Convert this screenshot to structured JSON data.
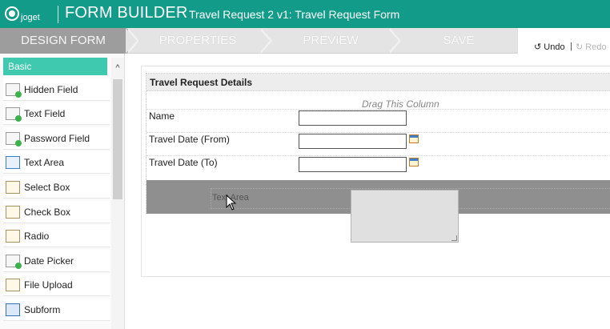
{
  "header": {
    "logo_text": "joget",
    "app_title": "FORM BUILDER",
    "form_title": "Travel Request 2 v1: Travel Request Form",
    "background": "#139b8a"
  },
  "steps": [
    {
      "label": "DESIGN FORM",
      "active": true
    },
    {
      "label": "PROPERTIES",
      "active": false
    },
    {
      "label": "PREVIEW",
      "active": false
    },
    {
      "label": "SAVE",
      "active": false
    }
  ],
  "history": {
    "undo_label": "Undo",
    "separator": "|",
    "redo_label": "Redo"
  },
  "palette": {
    "category": "Basic",
    "accent": "#3fcab0",
    "items": [
      {
        "label": "Hidden Field",
        "icon": "hidden-field-icon"
      },
      {
        "label": "Text Field",
        "icon": "text-field-icon"
      },
      {
        "label": "Password Field",
        "icon": "password-field-icon"
      },
      {
        "label": "Text Area",
        "icon": "text-area-icon"
      },
      {
        "label": "Select Box",
        "icon": "select-box-icon"
      },
      {
        "label": "Check Box",
        "icon": "check-box-icon"
      },
      {
        "label": "Radio",
        "icon": "radio-icon"
      },
      {
        "label": "Date Picker",
        "icon": "date-picker-icon"
      },
      {
        "label": "File Upload",
        "icon": "file-upload-icon"
      },
      {
        "label": "Subform",
        "icon": "subform-icon"
      }
    ]
  },
  "form": {
    "section_title": "Travel Request Details",
    "column_hint": "Drag This Column",
    "fields": [
      {
        "label": "Name",
        "value": "",
        "date_picker": false
      },
      {
        "label": "Travel Date (From)",
        "value": "",
        "date_picker": true
      },
      {
        "label": "Travel Date (To)",
        "value": "",
        "date_picker": true
      }
    ],
    "dragging_label": "Text Area"
  }
}
